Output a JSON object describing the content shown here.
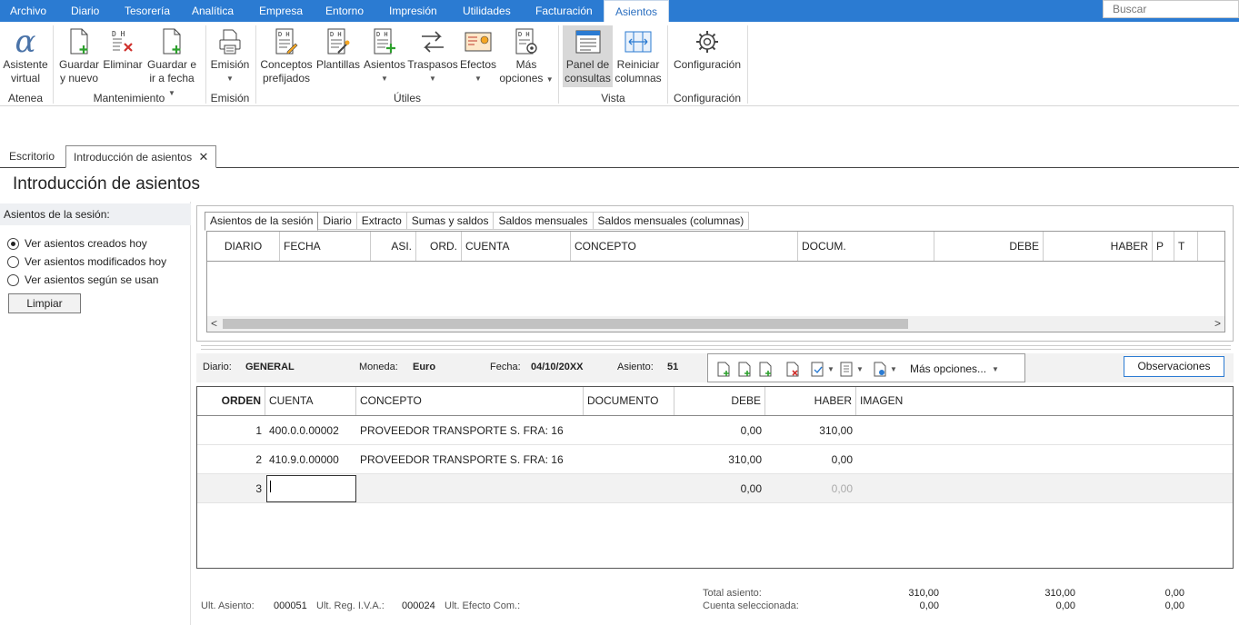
{
  "menu": {
    "items": [
      "Archivo",
      "Diario",
      "Tesorería",
      "Analítica",
      "Empresa",
      "Entorno",
      "Impresión",
      "Utilidades",
      "Facturación",
      "Asientos"
    ],
    "active": "Asientos"
  },
  "search": {
    "placeholder": "Buscar"
  },
  "ribbon": {
    "buttons": {
      "asistente": [
        "Asistente",
        "virtual"
      ],
      "guardar_nuevo": [
        "Guardar",
        "y nuevo"
      ],
      "eliminar": [
        "Eliminar"
      ],
      "guardar_fecha": [
        "Guardar e",
        "ir a fecha"
      ],
      "emision": [
        "Emisión"
      ],
      "conceptos": [
        "Conceptos",
        "prefijados"
      ],
      "plantillas": [
        "Plantillas"
      ],
      "asientos": [
        "Asientos"
      ],
      "traspasos": [
        "Traspasos"
      ],
      "efectos": [
        "Efectos"
      ],
      "mas_opciones": [
        "Más",
        "opciones"
      ],
      "panel": [
        "Panel de",
        "consultas"
      ],
      "reiniciar": [
        "Reiniciar",
        "columnas"
      ],
      "configuracion": [
        "Configuración"
      ]
    },
    "groups": {
      "atenea": "Atenea",
      "mantenimiento": "Mantenimiento",
      "emision": "Emisión",
      "utiles": "Útiles",
      "vista": "Vista",
      "configuracion": "Configuración"
    },
    "accent_color": "#2b7bd2"
  },
  "doc_tabs": {
    "escritorio": "Escritorio",
    "introduccion": "Introducción de asientos"
  },
  "page_title": "Introducción de asientos",
  "left_panel": {
    "heading": "Asientos de la sesión:",
    "options": [
      "Ver asientos creados hoy",
      "Ver asientos modificados hoy",
      "Ver asientos según se usan"
    ],
    "selected_index": 0,
    "clear_button": "Limpiar"
  },
  "session": {
    "tabs": [
      "Asientos de la sesión",
      "Diario",
      "Extracto",
      "Sumas y saldos",
      "Saldos mensuales",
      "Saldos mensuales (columnas)"
    ],
    "columns": [
      "DIARIO",
      "FECHA",
      "ASI.",
      "ORD.",
      "CUENTA",
      "CONCEPTO",
      "DOCUM.",
      "DEBE",
      "HABER",
      "P",
      "T"
    ]
  },
  "info": {
    "diario_label": "Diario:",
    "diario": "GENERAL",
    "moneda_label": "Moneda:",
    "moneda": "Euro",
    "fecha_label": "Fecha:",
    "fecha": "04/10/20XX",
    "asiento_label": "Asiento:",
    "asiento": "51",
    "mas_opciones": "Más opciones...",
    "observaciones": "Observaciones"
  },
  "grid": {
    "columns": [
      "ORDEN",
      "CUENTA",
      "CONCEPTO",
      "DOCUMENTO",
      "DEBE",
      "HABER",
      "IMAGEN"
    ],
    "rows": [
      {
        "orden": "1",
        "cuenta": "400.0.0.00002",
        "concepto": "PROVEEDOR TRANSPORTE S. FRA:  16",
        "documento": "",
        "debe": "0,00",
        "haber": "310,00"
      },
      {
        "orden": "2",
        "cuenta": "410.9.0.00000",
        "concepto": "PROVEEDOR TRANSPORTE S. FRA:  16",
        "documento": "",
        "debe": "310,00",
        "haber": "0,00"
      },
      {
        "orden": "3",
        "cuenta": "",
        "concepto": "",
        "documento": "",
        "debe": "0,00",
        "haber": "0,00"
      }
    ]
  },
  "footer": {
    "ult_asiento_label": "Ult. Asiento:",
    "ult_asiento": "000051",
    "ult_reg_label": "Ult. Reg. I.V.A.:",
    "ult_reg": "000024",
    "ult_efecto_label": "Ult. Efecto Com.:",
    "total_label": "Total asiento:",
    "total_debe": "310,00",
    "total_haber": "310,00",
    "total_saldo": "0,00",
    "cuenta_label": "Cuenta seleccionada:",
    "cuenta_debe": "0,00",
    "cuenta_haber": "0,00",
    "cuenta_saldo": "0,00"
  }
}
